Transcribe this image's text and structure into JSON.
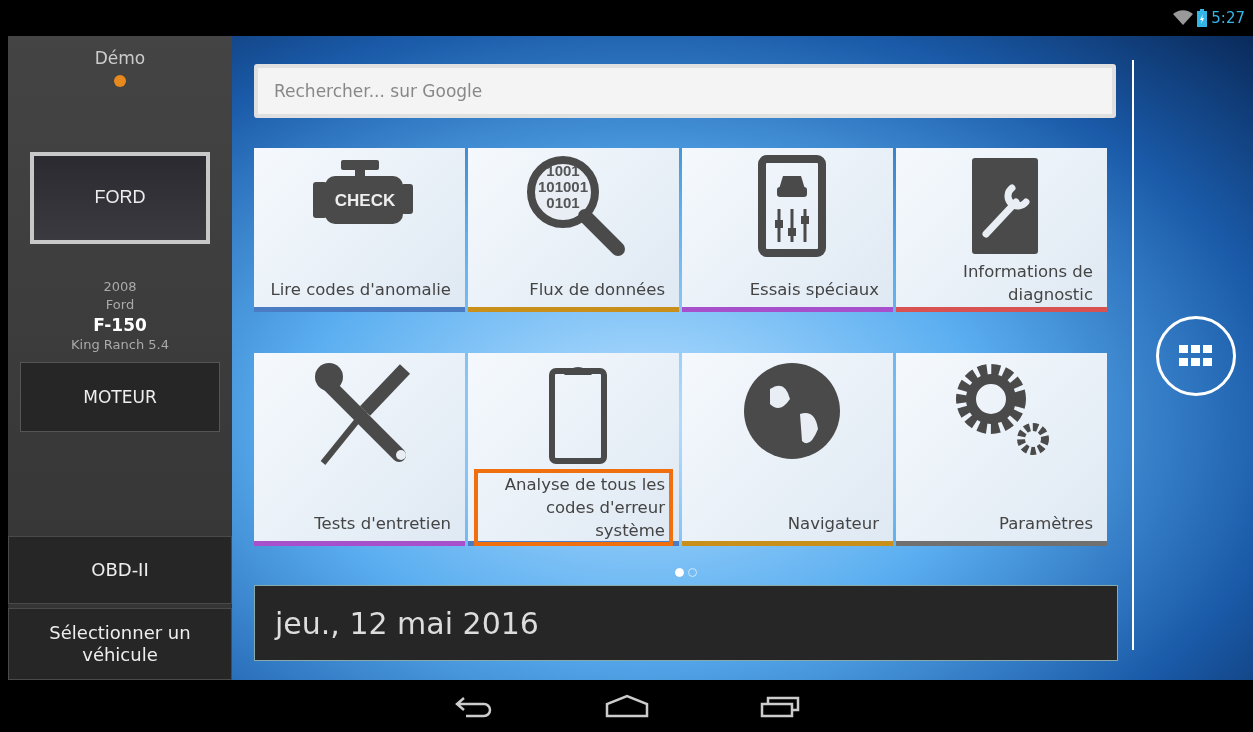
{
  "status_bar": {
    "time": "5:27"
  },
  "sidebar": {
    "mode": {
      "label": "Démo",
      "color": "#e8891e"
    },
    "brand": "FORD",
    "vehicle": {
      "year": "2008",
      "make": "Ford",
      "model": "F-150",
      "trim": "King Ranch 5.4"
    },
    "system_button": "MOTEUR",
    "buttons": [
      "OBD-II",
      "Sélectionner un véhicule"
    ]
  },
  "search": {
    "placeholder": "Rechercher... sur Google"
  },
  "tiles": [
    {
      "label": "Lire codes d'anomalie",
      "color": "#4a7cc4",
      "highlighted": false,
      "icon_text": [
        "CHECK"
      ]
    },
    {
      "label": "Flux de données",
      "color": "#c8901a",
      "highlighted": false,
      "icon_text": [
        "1001",
        "101001",
        "0101"
      ]
    },
    {
      "label": "Essais spéciaux",
      "color": "#a650cc",
      "highlighted": false
    },
    {
      "label": "Informations de diagnostic",
      "color": "#d85252",
      "highlighted": false
    },
    {
      "label": "Tests d'entretien",
      "color": "#a650cc",
      "highlighted": false
    },
    {
      "label": "Analyse de tous les codes d'erreur système",
      "color": "#4a7cc4",
      "highlighted": true
    },
    {
      "label": "Navigateur",
      "color": "#c8901a",
      "highlighted": false
    },
    {
      "label": "Paramètres",
      "color": "#707070",
      "highlighted": false
    }
  ],
  "pages": [
    {
      "selected": true
    },
    {
      "selected": false
    }
  ],
  "date": "jeu., 12 mai 2016"
}
